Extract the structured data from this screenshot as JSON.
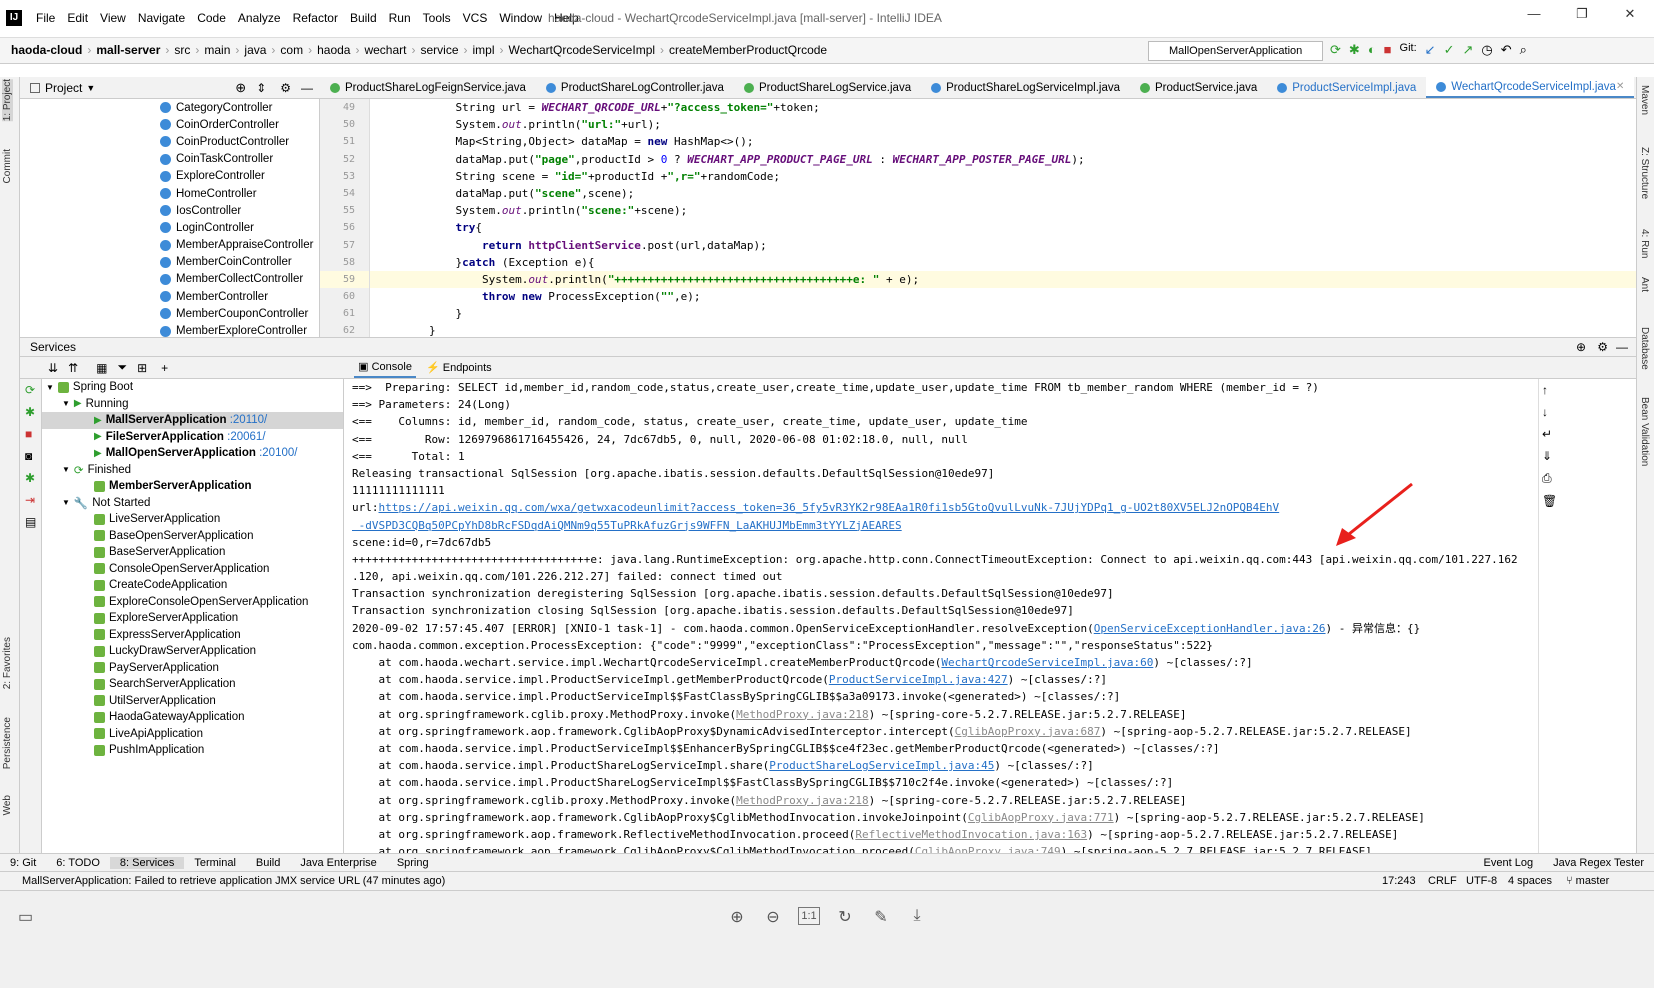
{
  "titlebar": {
    "logo": "IJ",
    "menu": [
      "File",
      "Edit",
      "View",
      "Navigate",
      "Code",
      "Analyze",
      "Refactor",
      "Build",
      "Run",
      "Tools",
      "VCS",
      "Window",
      "Help"
    ],
    "title": "haoda-cloud - WechartQrcodeServiceImpl.java [mall-server] - IntelliJ IDEA",
    "min": "—",
    "max": "❐",
    "close": "✕"
  },
  "breadcrumbs": [
    "haoda-cloud",
    "mall-server",
    "src",
    "main",
    "java",
    "com",
    "haoda",
    "wechart",
    "service",
    "impl",
    "WechartQrcodeServiceImpl",
    "createMemberProductQrcode"
  ],
  "run_config": "MallOpenServerApplication",
  "git_label": "Git:",
  "left_tabs": {
    "project": "1: Project",
    "commit": "Commit",
    "favorites": "2: Favorites",
    "persistence": "Persistence",
    "web": "Web"
  },
  "right_tabs": {
    "maven": "Maven",
    "structure": "Z: Structure",
    "run": "4: Run",
    "ant": "Ant",
    "database": "Database",
    "bean": "Bean Validation"
  },
  "project": {
    "header": "Project",
    "items": [
      "CategoryController",
      "CoinOrderController",
      "CoinProductController",
      "CoinTaskController",
      "ExploreController",
      "HomeController",
      "IosController",
      "LoginController",
      "MemberAppraiseController",
      "MemberCoinController",
      "MemberCollectController",
      "MemberController",
      "MemberCouponController",
      "MemberExploreController"
    ]
  },
  "editor_tabs": [
    "ProductShareLogFeignService.java",
    "ProductShareLogController.java",
    "ProductShareLogService.java",
    "ProductShareLogServiceImpl.java",
    "ProductService.java",
    "ProductServiceImpl.java",
    "WechartQrcodeServiceImpl.java"
  ],
  "code": {
    "lines": [
      "49",
      "50",
      "51",
      "52",
      "53",
      "54",
      "55",
      "56",
      "57",
      "58",
      "59",
      "60",
      "61",
      "62"
    ]
  },
  "services": {
    "header": "Services",
    "console_tab": "Console",
    "endpoints_tab": "Endpoints",
    "spring": "Spring Boot",
    "running": "Running",
    "finished": "Finished",
    "not_started": "Not Started",
    "running_apps": [
      {
        "name": "MallServerApplication",
        "port": ":20110/"
      },
      {
        "name": "FileServerApplication",
        "port": ":20061/"
      },
      {
        "name": "MallOpenServerApplication",
        "port": ":20100/"
      }
    ],
    "finished_apps": [
      "MemberServerApplication"
    ],
    "not_started_apps": [
      "LiveServerApplication",
      "BaseOpenServerApplication",
      "BaseServerApplication",
      "ConsoleOpenServerApplication",
      "CreateCodeApplication",
      "ExploreConsoleOpenServerApplication",
      "ExploreServerApplication",
      "ExpressServerApplication",
      "LuckyDrawServerApplication",
      "PayServerApplication",
      "SearchServerApplication",
      "UtilServerApplication",
      "HaodaGatewayApplication",
      "LiveApiApplication",
      "PushImApplication"
    ]
  },
  "console": {
    "l1": "==>  Preparing: SELECT id,member_id,random_code,status,create_user,create_time,update_user,update_time FROM tb_member_random WHERE (member_id = ?)",
    "l2": "==> Parameters: 24(Long)",
    "l3": "<==    Columns: id, member_id, random_code, status, create_user, create_time, update_user, update_time",
    "l4": "<==        Row: 1269796861716455426, 24, 7dc67db5, 0, null, 2020-06-08 01:02:18.0, null, null",
    "l5": "<==      Total: 1",
    "l6": "Releasing transactional SqlSession [org.apache.ibatis.session.defaults.DefaultSqlSession@10ede97]",
    "l7": "11111111111111",
    "l8a": "url:",
    "l8b": "https://api.weixin.qq.com/wxa/getwxacodeunlimit?access_token=36_5fy5vR3YK2r98EAa1R0fi1sb5GtoQvulLvuNk-7JUjYDPq1_g-UO2t80XV5ELJ2nOPQB4EhV",
    "l9": " -dVSPD3CQBq50PCpYhD8bRcFSDqdAiQMNm9q55TuPRkAfuzGrjs9WFFN_LaAKHUJMbEmm3tYYLZjAEARES",
    "l10": "scene:id=0,r=7dc67db5",
    "l11": "++++++++++++++++++++++++++++++++++++e: java.lang.RuntimeException: org.apache.http.conn.ConnectTimeoutException: Connect to api.weixin.qq.com:443 [api.weixin.qq.com/101.227.162",
    "l12": ".120, api.weixin.qq.com/101.226.212.27] failed: connect timed out",
    "l13": "Transaction synchronization deregistering SqlSession [org.apache.ibatis.session.defaults.DefaultSqlSession@10ede97]",
    "l14": "Transaction synchronization closing SqlSession [org.apache.ibatis.session.defaults.DefaultSqlSession@10ede97]",
    "l15a": "2020-09-02 17:57:45.407 [ERROR] [XNIO-1 task-1] - com.haoda.common.OpenServiceExceptionHandler.resolveException(",
    "l15b": "OpenServiceExceptionHandler.java:26",
    "l15c": ") - 异常信息：{}",
    "l16": "com.haoda.common.exception.ProcessException: {\"code\":\"9999\",\"exceptionClass\":\"ProcessException\",\"message\":\"\",\"responseStatus\":522}",
    "st": [
      {
        "a": "    at com.haoda.wechart.service.impl.WechartQrcodeServiceImpl.createMemberProductQrcode(",
        "l": "WechartQrcodeServiceImpl.java:60",
        "b": ") ~[classes/:?]",
        "g": false
      },
      {
        "a": "    at com.haoda.service.impl.ProductServiceImpl.getMemberProductQrcode(",
        "l": "ProductServiceImpl.java:427",
        "b": ") ~[classes/:?]",
        "g": false
      },
      {
        "a": "    at com.haoda.service.impl.ProductServiceImpl$$FastClassBySpringCGLIB$$a3a09173.invoke(<generated>) ~[classes/:?]",
        "l": "",
        "b": "",
        "g": false
      },
      {
        "a": "    at org.springframework.cglib.proxy.MethodProxy.invoke(",
        "l": "MethodProxy.java:218",
        "b": ") ~[spring-core-5.2.7.RELEASE.jar:5.2.7.RELEASE]",
        "g": true
      },
      {
        "a": "    at org.springframework.aop.framework.CglibAopProxy$DynamicAdvisedInterceptor.intercept(",
        "l": "CglibAopProxy.java:687",
        "b": ") ~[spring-aop-5.2.7.RELEASE.jar:5.2.7.RELEASE]",
        "g": true
      },
      {
        "a": "    at com.haoda.service.impl.ProductServiceImpl$$EnhancerBySpringCGLIB$$ce4f23ec.getMemberProductQrcode(<generated>) ~[classes/:?]",
        "l": "",
        "b": "",
        "g": false
      },
      {
        "a": "    at com.haoda.service.impl.ProductShareLogServiceImpl.share(",
        "l": "ProductShareLogServiceImpl.java:45",
        "b": ") ~[classes/:?]",
        "g": false
      },
      {
        "a": "    at com.haoda.service.impl.ProductShareLogServiceImpl$$FastClassBySpringCGLIB$$710c2f4e.invoke(<generated>) ~[classes/:?]",
        "l": "",
        "b": "",
        "g": false
      },
      {
        "a": "    at org.springframework.cglib.proxy.MethodProxy.invoke(",
        "l": "MethodProxy.java:218",
        "b": ") ~[spring-core-5.2.7.RELEASE.jar:5.2.7.RELEASE]",
        "g": true
      },
      {
        "a": "    at org.springframework.aop.framework.CglibAopProxy$CglibMethodInvocation.invokeJoinpoint(",
        "l": "CglibAopProxy.java:771",
        "b": ") ~[spring-aop-5.2.7.RELEASE.jar:5.2.7.RELEASE]",
        "g": true
      },
      {
        "a": "    at org.springframework.aop.framework.ReflectiveMethodInvocation.proceed(",
        "l": "ReflectiveMethodInvocation.java:163",
        "b": ") ~[spring-aop-5.2.7.RELEASE.jar:5.2.7.RELEASE]",
        "g": true
      },
      {
        "a": "    at org.springframework.aop.framework.CglibAopProxy$CglibMethodInvocation.proceed(",
        "l": "CglibAopProxy.java:749",
        "b": ") ~[spring-aop-5.2.7.RELEASE.jar:5.2.7.RELEASE]",
        "g": true
      }
    ]
  },
  "bottom_tabs": [
    "9: Git",
    "6: TODO",
    "8: Services",
    "Terminal",
    "Build",
    "Java Enterprise",
    "Spring",
    "Event Log",
    "Java Regex Tester"
  ],
  "status": {
    "message": "MallServerApplication: Failed to retrieve application JMX service URL (47 minutes ago)",
    "pos": "17:243",
    "crlf": "CRLF",
    "enc": "UTF-8",
    "indent": "4 spaces",
    "branch": "master"
  },
  "colors": {
    "accent": "#2470c7",
    "arrow": "#e8201c"
  }
}
